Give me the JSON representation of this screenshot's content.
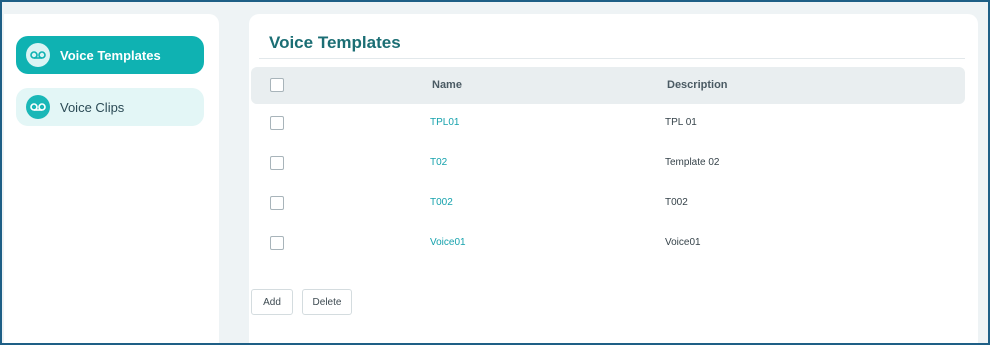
{
  "sidebar": {
    "items": [
      {
        "label": "Voice Templates",
        "icon": "voicemail-icon",
        "active": true
      },
      {
        "label": "Voice Clips",
        "icon": "voicemail-icon",
        "active": false
      }
    ]
  },
  "main": {
    "title": "Voice Templates",
    "table": {
      "columns": [
        "Name",
        "Description"
      ],
      "rows": [
        {
          "name": "TPL01",
          "description": "TPL 01"
        },
        {
          "name": "T02",
          "description": "Template 02"
        },
        {
          "name": "T002",
          "description": "T002"
        },
        {
          "name": "Voice01",
          "description": "Voice01"
        }
      ]
    },
    "buttons": {
      "add": "Add",
      "delete": "Delete"
    }
  },
  "colors": {
    "accent": "#0fb2b2",
    "title": "#1b6e74",
    "link": "#16a2ad",
    "frame_border": "#1e5f86"
  }
}
